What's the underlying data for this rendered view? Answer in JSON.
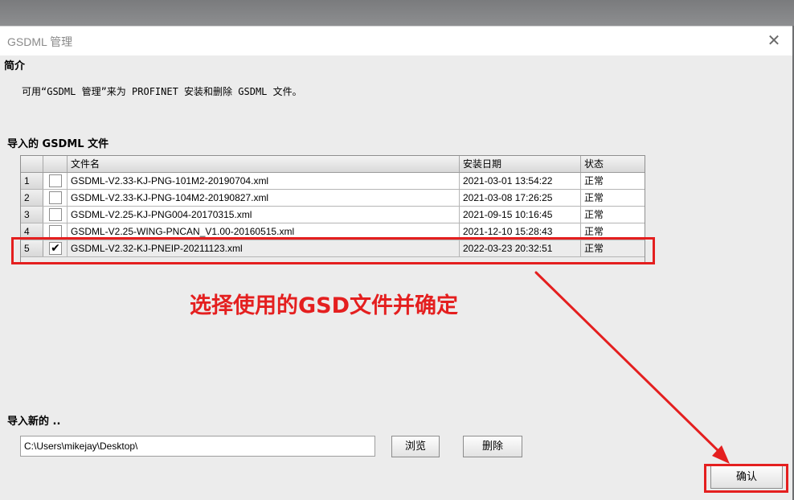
{
  "window": {
    "title": "GSDML 管理",
    "close_label": "✕"
  },
  "intro": {
    "heading": "简介",
    "description": "可用“GSDML 管理”来为 PROFINET 安装和删除 GSDML 文件。"
  },
  "import_section": {
    "heading": "导入的 GSDML 文件",
    "columns": [
      "文件名",
      "安装日期",
      "状态"
    ],
    "rows": [
      {
        "num": "1",
        "checked": "",
        "file": "GSDML-V2.33-KJ-PNG-101M2-20190704.xml",
        "date": "2021-03-01 13:54:22",
        "status": "正常"
      },
      {
        "num": "2",
        "checked": "",
        "file": "GSDML-V2.33-KJ-PNG-104M2-20190827.xml",
        "date": "2021-03-08 17:26:25",
        "status": "正常"
      },
      {
        "num": "3",
        "checked": "",
        "file": "GSDML-V2.25-KJ-PNG004-20170315.xml",
        "date": "2021-09-15 10:16:45",
        "status": "正常"
      },
      {
        "num": "4",
        "checked": "",
        "file": "GSDML-V2.25-WING-PNCAN_V1.00-20160515.xml",
        "date": "2021-12-10 15:28:43",
        "status": "正常"
      },
      {
        "num": "5",
        "checked": "✔",
        "file": "GSDML-V2.32-KJ-PNEIP-20211123.xml",
        "date": "2022-03-23 20:32:51",
        "status": "正常"
      }
    ]
  },
  "annotation": {
    "text": "选择使用的GSD文件并确定",
    "color": "#e41f1f"
  },
  "import_new": {
    "heading": "导入新的 ..",
    "path_value": "C:\\Users\\mikejay\\Desktop\\",
    "browse_label": "浏览",
    "delete_label": "删除"
  },
  "confirm_label": "确认"
}
